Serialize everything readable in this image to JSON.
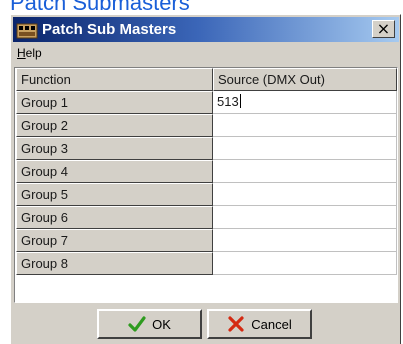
{
  "page": {
    "heading": "Patch Submasters"
  },
  "dialog": {
    "title": "Patch Sub Masters",
    "title_icon": "app-icon",
    "close_label": "×",
    "menu": {
      "help_label_mnemonic": "H",
      "help_label_rest": "elp"
    },
    "grid": {
      "headers": {
        "function": "Function",
        "source": "Source (DMX Out)"
      },
      "rows": [
        {
          "function": "Group 1",
          "source": "513"
        },
        {
          "function": "Group 2",
          "source": ""
        },
        {
          "function": "Group 3",
          "source": ""
        },
        {
          "function": "Group 4",
          "source": ""
        },
        {
          "function": "Group 5",
          "source": ""
        },
        {
          "function": "Group 6",
          "source": ""
        },
        {
          "function": "Group 7",
          "source": ""
        },
        {
          "function": "Group 8",
          "source": ""
        }
      ]
    },
    "buttons": {
      "ok_label": "OK",
      "ok_icon": "checkmark-icon",
      "cancel_label": "Cancel",
      "cancel_icon": "x-icon"
    },
    "colors": {
      "title_gradient_start": "#0a246a",
      "title_gradient_end": "#a6caf0",
      "face": "#d4d0c8",
      "heading_blue": "#1a5fd8",
      "ok_green": "#2e9b1f",
      "cancel_red": "#d42a12"
    }
  }
}
